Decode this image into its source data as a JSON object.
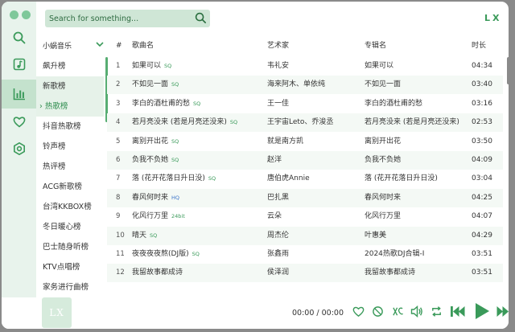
{
  "app": {
    "brand": "LX",
    "cover_text": "LX"
  },
  "colors": {
    "accent": "#3a9a5a",
    "sidebar_bg": "#e8f3ec"
  },
  "nav": [
    {
      "name": "search-nav-icon",
      "icon": "search-icon"
    },
    {
      "name": "song-list-nav-icon",
      "icon": "music-list-icon"
    },
    {
      "name": "leaderboard-nav-icon",
      "icon": "chart-bars-icon",
      "active": true
    },
    {
      "name": "favorites-nav-icon",
      "icon": "heart-icon"
    },
    {
      "name": "settings-nav-icon",
      "icon": "settings-icon"
    }
  ],
  "search": {
    "placeholder": "Search for something..."
  },
  "source": {
    "label": "小蜗音乐"
  },
  "lists": [
    "飙升榜",
    "新歌榜",
    "热歌榜",
    "抖音热歌榜",
    "铃声榜",
    "热评榜",
    "ACG新歌榜",
    "台湾KKBOX榜",
    "冬日暖心榜",
    "巴士随身听榜",
    "KTV点唱榜",
    "家务进行曲榜"
  ],
  "lists_selected_index": 2,
  "lists_selected_marker": "›",
  "table": {
    "headers": {
      "index": "#",
      "title": "歌曲名",
      "artist": "艺术家",
      "album": "专辑名",
      "duration": "时长"
    },
    "rows": [
      {
        "index": "1",
        "title": "如果可以",
        "badge": "SQ",
        "artist": "韦礼安",
        "album": "如果可以",
        "duration": "04:34"
      },
      {
        "index": "2",
        "title": "不如见一面",
        "badge": "SQ",
        "artist": "海来阿木、单依纯",
        "album": "不如见一面",
        "duration": "03:40"
      },
      {
        "index": "3",
        "title": "李白的酒杜甫的愁",
        "badge": "SQ",
        "artist": "王一佳",
        "album": "李白的酒杜甫的愁",
        "duration": "03:16"
      },
      {
        "index": "4",
        "title": "若月亮没来 (若是月亮还没来)",
        "badge": "SQ",
        "artist": "王宇宙Leto、乔浚丞",
        "album": "若月亮没来 (若是月亮还没来)",
        "duration": "02:53"
      },
      {
        "index": "5",
        "title": "离别开出花",
        "badge": "SQ",
        "artist": "就是南方凯",
        "album": "离别开出花",
        "duration": "03:50"
      },
      {
        "index": "6",
        "title": "负我不负她",
        "badge": "SQ",
        "artist": "赵洋",
        "album": "负我不负她",
        "duration": "04:09"
      },
      {
        "index": "7",
        "title": "落 (花开花落日升日没)",
        "badge": "SQ",
        "artist": "唐伯虎Annie",
        "album": "落 (花开花落日升日没)",
        "duration": "03:04"
      },
      {
        "index": "8",
        "title": "春风何时来",
        "badge": "HQ",
        "artist": "巴扎黑",
        "album": "春风何时来",
        "duration": "04:25"
      },
      {
        "index": "9",
        "title": "化风行万里",
        "badge": "24bit",
        "artist": "云朵",
        "album": "化风行万里",
        "duration": "04:07"
      },
      {
        "index": "10",
        "title": "晴天",
        "badge": "SQ",
        "artist": "周杰伦",
        "album": "叶惠美",
        "duration": "04:29"
      },
      {
        "index": "11",
        "title": "夜夜夜夜熬(DJ版)",
        "badge": "SQ",
        "artist": "张鑫雨",
        "album": "2024热歌DJ合辑-I",
        "duration": "03:51"
      },
      {
        "index": "12",
        "title": "我留故事都成诗",
        "badge": "",
        "artist": "侯泽润",
        "album": "我留故事都成诗",
        "duration": "03:51"
      }
    ]
  },
  "player": {
    "time": "00:00 / 00:00",
    "controls": [
      "heart-outline-icon",
      "dislike-icon",
      "lyrics-toggle-icon",
      "volume-icon",
      "repeat-icon",
      "previous-track-icon",
      "play-icon",
      "next-track-icon"
    ]
  }
}
